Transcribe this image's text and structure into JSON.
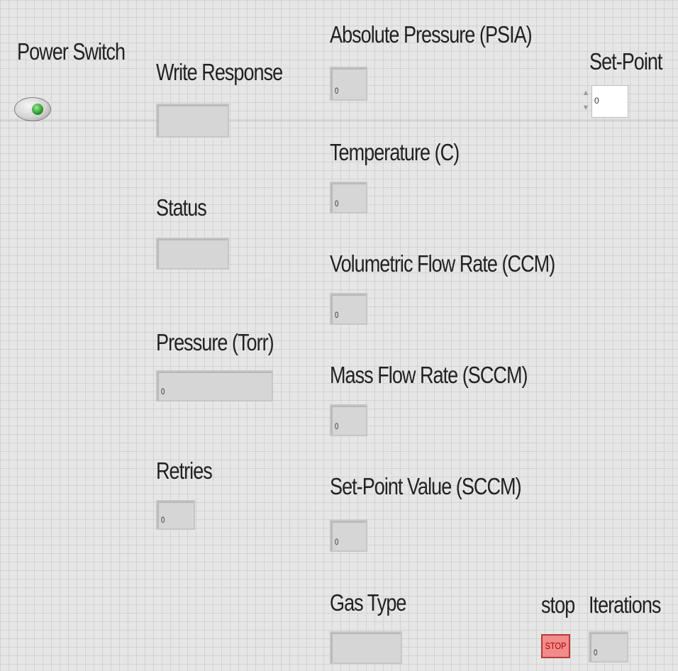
{
  "power_switch": {
    "label": "Power Switch",
    "state": "on"
  },
  "write_response": {
    "label": "Write Response",
    "value": ""
  },
  "status": {
    "label": "Status",
    "value": ""
  },
  "pressure_torr": {
    "label": "Pressure (Torr)",
    "value": "0"
  },
  "retries": {
    "label": "Retries",
    "value": "0"
  },
  "absolute_pressure": {
    "label": "Absolute Pressure (PSIA)",
    "value": "0"
  },
  "temperature": {
    "label": "Temperature (C)",
    "value": "0"
  },
  "volumetric_flow": {
    "label": "Volumetric Flow Rate (CCM)",
    "value": "0"
  },
  "mass_flow": {
    "label": "Mass Flow Rate (SCCM)",
    "value": "0"
  },
  "set_point_value": {
    "label": "Set-Point Value (SCCM)",
    "value": "0"
  },
  "gas_type": {
    "label": "Gas Type",
    "value": ""
  },
  "set_point": {
    "label": "Set-Point",
    "value": "0",
    "up_arrow": "▲",
    "down_arrow": "▼"
  },
  "stop": {
    "label": "stop",
    "button_text": "STOP"
  },
  "iterations": {
    "label": "Iterations",
    "value": "0"
  },
  "colors": {
    "panel_background": "#e6e6e6",
    "grid_line": "#d2d2d2",
    "indicator_fill": "#d6d6d6",
    "power_led": "#2a9a2a",
    "stop_fill": "#f28b8b",
    "stop_text": "#b00000"
  },
  "icons": {
    "power_switch": "toggle-switch-icon",
    "power_led": "led-icon"
  }
}
